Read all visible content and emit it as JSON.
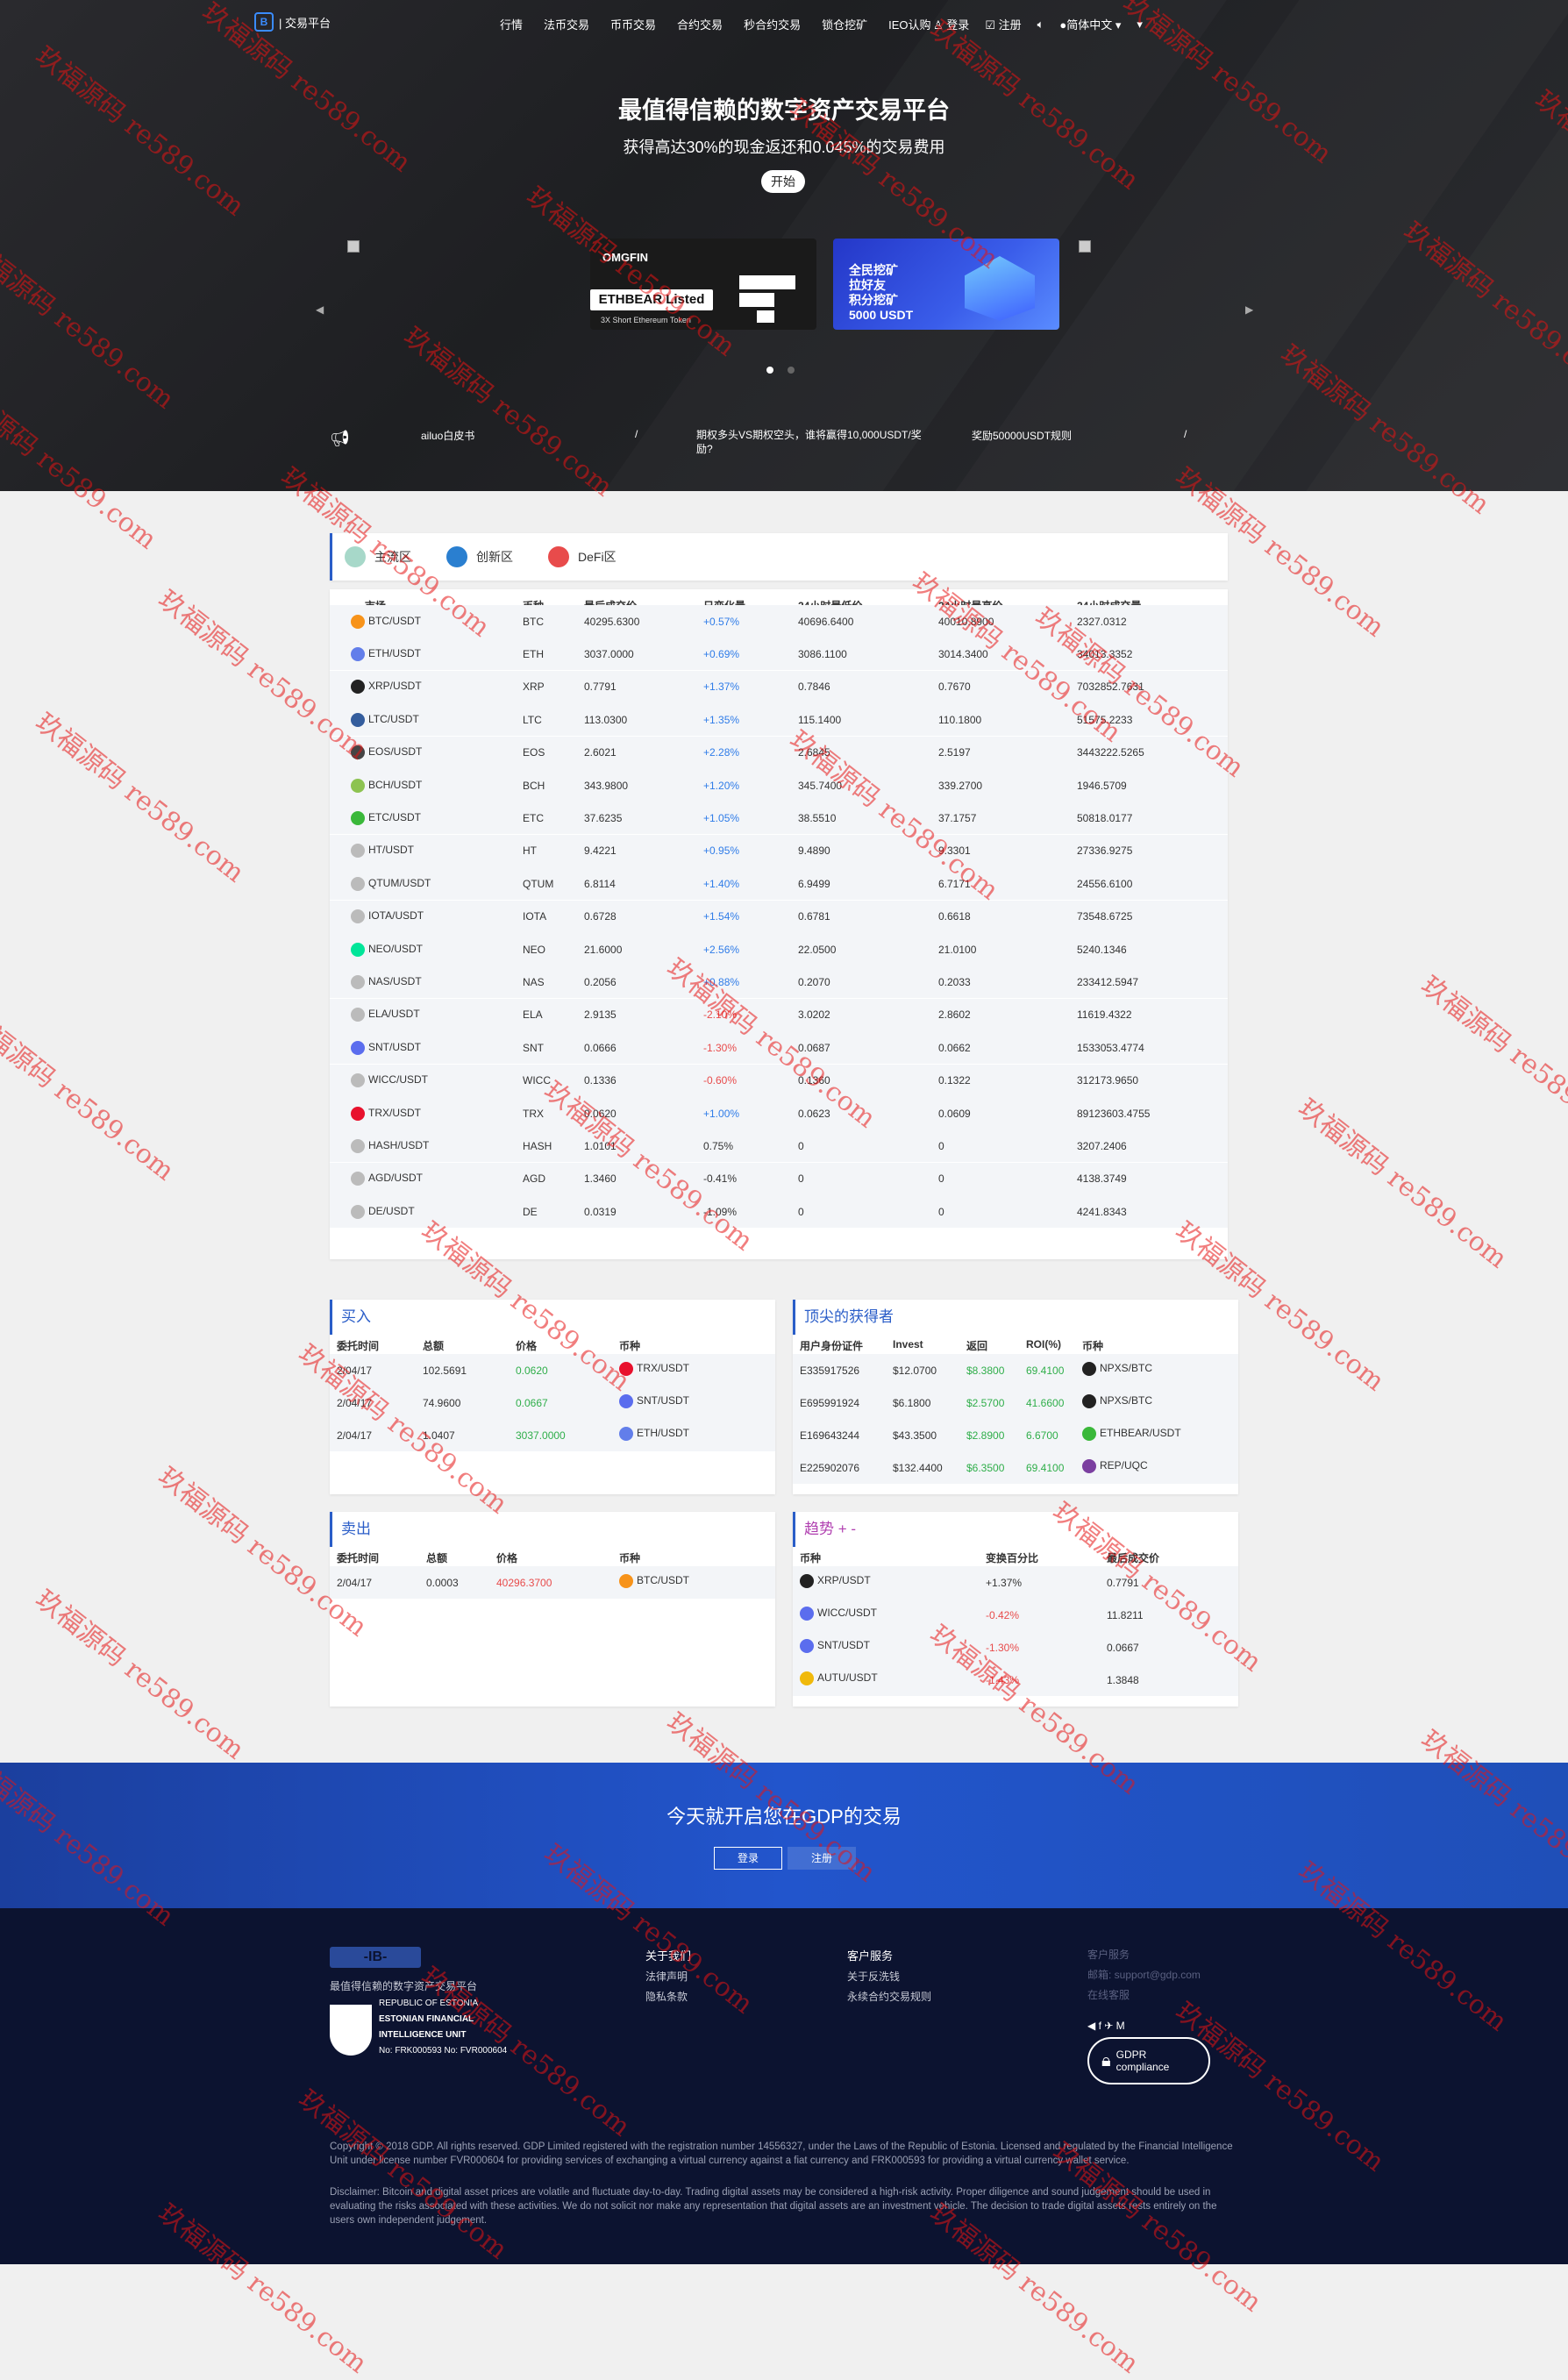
{
  "nav": {
    "logo_text": "| 交易平台",
    "links": [
      "行情",
      "法币交易",
      "币币交易",
      "合约交易",
      "秒合约交易",
      "锁仓挖矿",
      "IEO认购"
    ],
    "login": "登录",
    "register": "注册",
    "language": "简体中文"
  },
  "hero": {
    "title": "最值得信赖的数字资产交易平台",
    "subtitle": "获得高达30%的现金返还和0.045%的交易费用",
    "start_label": "开始",
    "banner1": {
      "brand": "OMGFIN",
      "headline": "ETHBEAR Listed",
      "tagline": "3X Short Ethereum Token"
    },
    "banner2": {
      "lines": [
        "全民挖矿",
        "拉好友",
        "积分挖矿",
        "5000 USDT"
      ]
    }
  },
  "notices": [
    "ailuo白皮书",
    "/",
    "期权多头VS期权空头，谁将赢得10,000USDT/奖励?",
    "奖励50000USDT规则",
    "/"
  ],
  "zones": [
    "主流区",
    "创新区",
    "DeFi区"
  ],
  "market": {
    "headers": [
      "市场",
      "币种",
      "最后成交价",
      "日变化量",
      "24小时最低价",
      "24小时最高价",
      "24小时成交量"
    ],
    "rows": [
      {
        "pair": "BTC/USDT",
        "coin": "BTC",
        "last": "40295.6300",
        "change": "+0.57%",
        "low": "40696.6400",
        "high": "40010.8900",
        "vol": "2327.0312",
        "dir": "up",
        "color": "#f7931a"
      },
      {
        "pair": "ETH/USDT",
        "coin": "ETH",
        "last": "3037.0000",
        "change": "+0.69%",
        "low": "3086.1100",
        "high": "3014.3400",
        "vol": "34013.3352",
        "dir": "up",
        "color": "#627eea"
      },
      {
        "pair": "XRP/USDT",
        "coin": "XRP",
        "last": "0.7791",
        "change": "+1.37%",
        "low": "0.7846",
        "high": "0.7670",
        "vol": "7032852.7631",
        "dir": "up",
        "color": "#222"
      },
      {
        "pair": "LTC/USDT",
        "coin": "LTC",
        "last": "113.0300",
        "change": "+1.35%",
        "low": "115.1400",
        "high": "110.1800",
        "vol": "51575.2233",
        "dir": "up",
        "color": "#345d9d"
      },
      {
        "pair": "EOS/USDT",
        "coin": "EOS",
        "last": "2.6021",
        "change": "+2.28%",
        "low": "2.6845",
        "high": "2.5197",
        "vol": "3443222.5265",
        "dir": "up",
        "color": "#444"
      },
      {
        "pair": "BCH/USDT",
        "coin": "BCH",
        "last": "343.9800",
        "change": "+1.20%",
        "low": "345.7400",
        "high": "339.2700",
        "vol": "1946.5709",
        "dir": "up",
        "color": "#8dc351"
      },
      {
        "pair": "ETC/USDT",
        "coin": "ETC",
        "last": "37.6235",
        "change": "+1.05%",
        "low": "38.5510",
        "high": "37.1757",
        "vol": "50818.0177",
        "dir": "up",
        "color": "#3ab83a"
      },
      {
        "pair": "HT/USDT",
        "coin": "HT",
        "last": "9.4221",
        "change": "+0.95%",
        "low": "9.4890",
        "high": "9.3301",
        "vol": "27336.9275",
        "dir": "up",
        "color": "#bbb"
      },
      {
        "pair": "QTUM/USDT",
        "coin": "QTUM",
        "last": "6.8114",
        "change": "+1.40%",
        "low": "6.9499",
        "high": "6.7171",
        "vol": "24556.6100",
        "dir": "up",
        "color": "#bbb"
      },
      {
        "pair": "IOTA/USDT",
        "coin": "IOTA",
        "last": "0.6728",
        "change": "+1.54%",
        "low": "0.6781",
        "high": "0.6618",
        "vol": "73548.6725",
        "dir": "up",
        "color": "#bbb"
      },
      {
        "pair": "NEO/USDT",
        "coin": "NEO",
        "last": "21.6000",
        "change": "+2.56%",
        "low": "22.0500",
        "high": "21.0100",
        "vol": "5240.1346",
        "dir": "up",
        "color": "#00e599"
      },
      {
        "pair": "NAS/USDT",
        "coin": "NAS",
        "last": "0.2056",
        "change": "+0.88%",
        "low": "0.2070",
        "high": "0.2033",
        "vol": "233412.5947",
        "dir": "up",
        "color": "#bbb"
      },
      {
        "pair": "ELA/USDT",
        "coin": "ELA",
        "last": "2.9135",
        "change": "-2.10%",
        "low": "3.0202",
        "high": "2.8602",
        "vol": "11619.4322",
        "dir": "down",
        "color": "#bbb"
      },
      {
        "pair": "SNT/USDT",
        "coin": "SNT",
        "last": "0.0666",
        "change": "-1.30%",
        "low": "0.0687",
        "high": "0.0662",
        "vol": "1533053.4774",
        "dir": "down",
        "color": "#5b6dee"
      },
      {
        "pair": "WICC/USDT",
        "coin": "WICC",
        "last": "0.1336",
        "change": "-0.60%",
        "low": "0.1360",
        "high": "0.1322",
        "vol": "312173.9650",
        "dir": "down",
        "color": "#bbb"
      },
      {
        "pair": "TRX/USDT",
        "coin": "TRX",
        "last": "0.0620",
        "change": "+1.00%",
        "low": "0.0623",
        "high": "0.0609",
        "vol": "89123603.4755",
        "dir": "up",
        "color": "#e8112d"
      },
      {
        "pair": "HASH/USDT",
        "coin": "HASH",
        "last": "1.0101",
        "change": "0.75%",
        "low": "0",
        "high": "0",
        "vol": "3207.2406",
        "dir": "flat",
        "color": "#bbb"
      },
      {
        "pair": "AGD/USDT",
        "coin": "AGD",
        "last": "1.3460",
        "change": "-0.41%",
        "low": "0",
        "high": "0",
        "vol": "4138.3749",
        "dir": "flat",
        "color": "#bbb"
      },
      {
        "pair": "DE/USDT",
        "coin": "DE",
        "last": "0.0319",
        "change": "-1.09%",
        "low": "0",
        "high": "0",
        "vol": "4241.8343",
        "dir": "flat",
        "color": "#bbb"
      }
    ]
  },
  "buy": {
    "title": "买入",
    "headers": [
      "委托时间",
      "总额",
      "价格",
      "币种"
    ],
    "rows": [
      {
        "time": "2/04/17",
        "total": "102.5691",
        "price": "0.0620",
        "pair": "TRX/USDT",
        "color": "#e8112d"
      },
      {
        "time": "2/04/17",
        "total": "74.9600",
        "price": "0.0667",
        "pair": "SNT/USDT",
        "color": "#5b6dee"
      },
      {
        "time": "2/04/17",
        "total": "1.0407",
        "price": "3037.0000",
        "pair": "ETH/USDT",
        "color": "#627eea"
      }
    ]
  },
  "sell": {
    "title": "卖出",
    "headers": [
      "委托时间",
      "总额",
      "价格",
      "币种"
    ],
    "rows": [
      {
        "time": "2/04/17",
        "total": "0.0003",
        "price": "40296.3700",
        "pair": "BTC/USDT",
        "color": "#f7931a"
      }
    ]
  },
  "top": {
    "title": "顶尖的获得者",
    "headers": [
      "用户身份证件",
      "Invest",
      "返回",
      "ROI(%)",
      "币种"
    ],
    "rows": [
      {
        "id": "E335917526",
        "invest": "$12.0700",
        "ret": "$8.3800",
        "roi": "69.4100",
        "pair": "NPXS/BTC",
        "color": "#222"
      },
      {
        "id": "E695991924",
        "invest": "$6.1800",
        "ret": "$2.5700",
        "roi": "41.6600",
        "pair": "NPXS/BTC",
        "color": "#222"
      },
      {
        "id": "E169643244",
        "invest": "$43.3500",
        "ret": "$2.8900",
        "roi": "6.6700",
        "pair": "ETHBEAR/USDT",
        "color": "#3ab83a"
      },
      {
        "id": "E225902076",
        "invest": "$132.4400",
        "ret": "$6.3500",
        "roi": "69.4100",
        "pair": "REP/UQC",
        "color": "#7b3fa0"
      }
    ]
  },
  "trend": {
    "title": "趋势 + -",
    "headers": [
      "币种",
      "变换百分比",
      "最后成交价"
    ],
    "rows": [
      {
        "pair": "XRP/USDT",
        "pct": "+1.37%",
        "price": "0.7791",
        "dir": "up",
        "color": "#222"
      },
      {
        "pair": "WICC/USDT",
        "pct": "-0.42%",
        "price": "11.8211",
        "dir": "down",
        "color": "#5b6dee"
      },
      {
        "pair": "SNT/USDT",
        "pct": "-1.30%",
        "price": "0.0667",
        "dir": "down",
        "color": "#5b6dee"
      },
      {
        "pair": "AUTU/USDT",
        "pct": "-1.43%",
        "price": "1.3848",
        "dir": "down",
        "color": "#f0b90b"
      }
    ]
  },
  "cta": {
    "title": "今天就开启您在GDP的交易",
    "login": "登录",
    "register": "注册"
  },
  "footer": {
    "tagline": "最值得信赖的数字资产交易平台",
    "estonia": [
      "REPUBLIC OF ESTONIA",
      "ESTONIAN FINANCIAL",
      "INTELLIGENCE UNIT",
      "No: FRK000593 No: FVR000604"
    ],
    "about_title": "关于我们",
    "about_links": [
      "法律声明",
      "隐私条款"
    ],
    "service_title": "客户服务",
    "service_links": [
      "关于反洗钱",
      "永续合约交易规则"
    ],
    "contact_title": "客户服务",
    "contact_email": "邮箱: support@gdp.com",
    "contact_extra": "在线客服",
    "social": "◀ f ✈ M",
    "gdpr": [
      "GDPR",
      "compliance"
    ],
    "copyright": "Copyright © 2018 GDP. All rights reserved. GDP Limited registered with the registration number 14556327, under the Laws of the Republic of Estonia. Licensed and regulated by the Financial Intelligence Unit under license number FVR000604 for providing services of exchanging a virtual currency against a fiat currency and FRK000593 for providing a virtual currency wallet service.",
    "disclaimer": "Disclaimer: Bitcoin and digital asset prices are volatile and fluctuate day-to-day. Trading digital assets may be considered a high-risk activity. Proper diligence and sound judgement should be used in evaluating the risks associated with these activities. We do not solicit nor make any representation that digital assets are an investment vehicle. The decision to trade digital assets rests entirely on the users own independent judgement."
  },
  "watermark": "玖福源码 re589.com"
}
